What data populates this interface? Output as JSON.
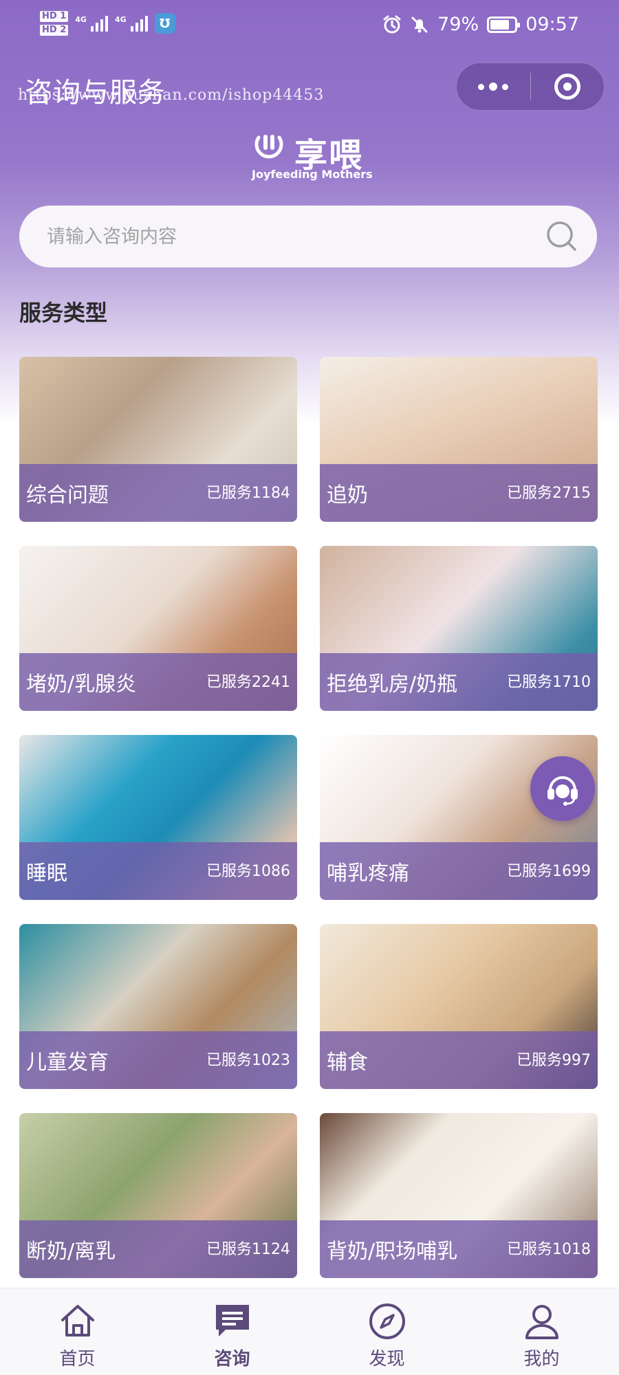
{
  "status_bar": {
    "hd1": "HD 1",
    "hd2": "HD 2",
    "net1": "4G",
    "net2": "4G",
    "battery_text": "79%",
    "battery_level": 0.79,
    "time": "09:57",
    "icons": [
      "alarm-icon",
      "mute-icon",
      "battery-icon"
    ]
  },
  "header": {
    "title": "咨询与服务",
    "watermark": "https://www.huzhan.com/ishop44453"
  },
  "logo": {
    "name": "享喂",
    "subtitle": "Joyfeeding Mothers"
  },
  "search": {
    "placeholder": "请输入咨询内容",
    "value": ""
  },
  "section": {
    "title": "服务类型"
  },
  "services": [
    {
      "name": "综合问题",
      "count": "已服务1184"
    },
    {
      "name": "追奶",
      "count": "已服务2715"
    },
    {
      "name": "堵奶/乳腺炎",
      "count": "已服务2241"
    },
    {
      "name": "拒绝乳房/奶瓶",
      "count": "已服务1710"
    },
    {
      "name": "睡眠",
      "count": "已服务1086"
    },
    {
      "name": "哺乳疼痛",
      "count": "已服务1699"
    },
    {
      "name": "儿童发育",
      "count": "已服务1023"
    },
    {
      "name": "辅食",
      "count": "已服务997"
    },
    {
      "name": "断奶/离乳",
      "count": "已服务1124"
    },
    {
      "name": "背奶/职场哺乳",
      "count": "已服务1018"
    }
  ],
  "tabbar": {
    "active": "咨询",
    "items": [
      {
        "label": "首页",
        "icon": "home-icon"
      },
      {
        "label": "咨询",
        "icon": "chat-icon"
      },
      {
        "label": "发现",
        "icon": "compass-icon"
      },
      {
        "label": "我的",
        "icon": "user-icon"
      }
    ]
  },
  "colors": {
    "primary": "#8c6ac6",
    "card_overlay": "#765caa",
    "tab_icon": "#5b4a7a"
  }
}
